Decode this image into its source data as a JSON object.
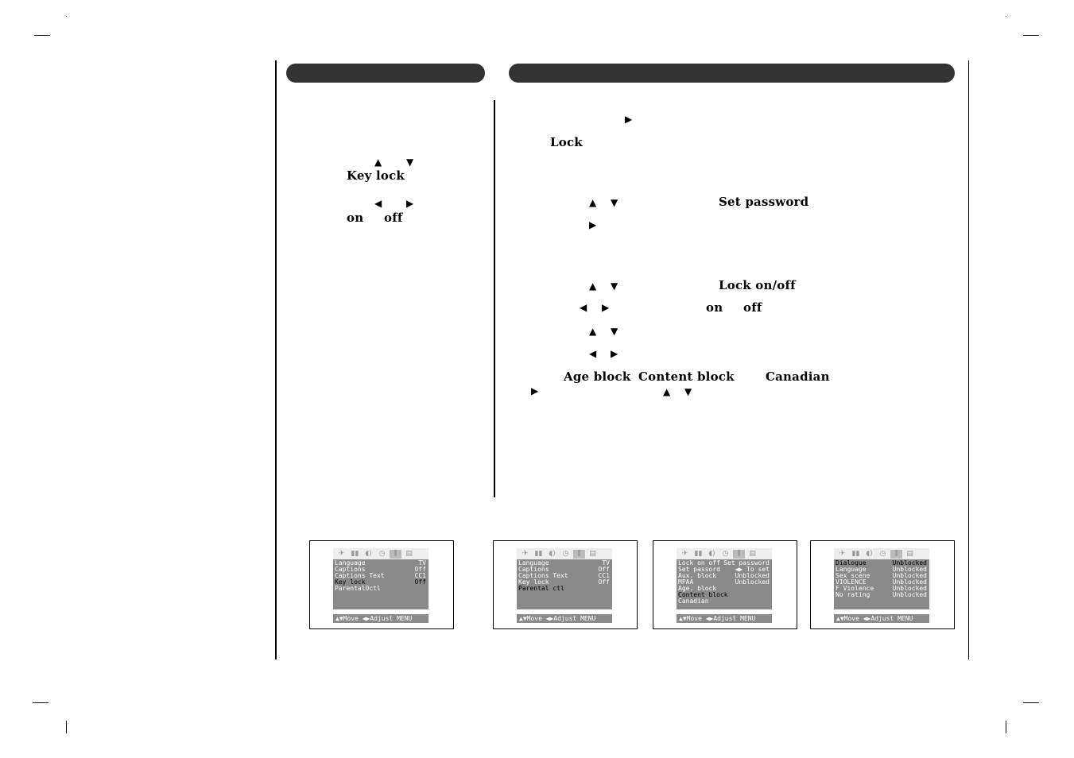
{
  "left_column": {
    "arrows_updown": [
      "▲",
      "▼"
    ],
    "key_lock_label": "Key lock",
    "arrows_leftright": [
      "◀",
      "▶"
    ],
    "on_label": "on",
    "off_label": "off"
  },
  "right_column": {
    "step1_arrow": "▶",
    "lock_label": "Lock",
    "step2_arrows": [
      "▲",
      "▼"
    ],
    "set_password_label": "Set password",
    "step2_right_arrow": "▶",
    "step3_arrows": [
      "▲",
      "▼"
    ],
    "lock_onoff_label": "Lock on/off",
    "step4_arrows": [
      "◀",
      "▶"
    ],
    "on_label": "on",
    "off_label": "off",
    "step5_arrows": [
      "▲",
      "▼"
    ],
    "step6_arrows": [
      "◀",
      "▶"
    ],
    "age_block_label": "Age block",
    "content_block_label": "Content block",
    "canadian_label": "Canadian",
    "step7_right_arrow": "▶",
    "step7_arrows": [
      "▲",
      "▼"
    ]
  },
  "icons": [
    "satellite-icon",
    "picture-icon",
    "sound-icon",
    "clock-icon",
    "special-icon",
    "screen-icon"
  ],
  "icon_glyphs": [
    "✈",
    "▮▮",
    "◖)",
    "◷",
    "⫼",
    "▤"
  ],
  "screens": [
    {
      "rows": [
        {
          "label": "Language",
          "value": "TV",
          "selected": false
        },
        {
          "label": "Captions",
          "value": "Off",
          "selected": false
        },
        {
          "label": "Captions Text",
          "value": "CC1",
          "selected": false
        },
        {
          "label": "Key lock",
          "value": "Off",
          "selected": true
        },
        {
          "label": "ParentalOctl",
          "value": "",
          "selected": false
        }
      ],
      "footer": "▲▼Move ◀▶Adjust MENU"
    },
    {
      "rows": [
        {
          "label": "Language",
          "value": "TV",
          "selected": false
        },
        {
          "label": "Captions",
          "value": "Off",
          "selected": false
        },
        {
          "label": "Captions Text",
          "value": "CC1",
          "selected": false
        },
        {
          "label": "Key lock",
          "value": "Off",
          "selected": false
        },
        {
          "label": "Parental ctl",
          "value": "",
          "selected": true
        }
      ],
      "footer": "▲▼Move ◀▶Adjust MENU"
    },
    {
      "rows": [
        {
          "label": "Lock on off",
          "value": "Set password",
          "selected": false
        },
        {
          "label": "Set passord",
          "value": "◀▶ To set",
          "selected": false
        },
        {
          "label": "Aux. block",
          "value": "Unblocked",
          "selected": false
        },
        {
          "label": "MPAA",
          "value": "Unblocked",
          "selected": false
        },
        {
          "label": "Age. block",
          "value": "",
          "selected": false
        },
        {
          "label": "Content block",
          "value": "",
          "selected": true
        },
        {
          "label": "Canadian",
          "value": "",
          "selected": false
        }
      ],
      "footer": "▲▼Move ◀▶Adjust MENU"
    },
    {
      "rows": [
        {
          "label": "Dialogue",
          "value": "Unblocked",
          "selected": true
        },
        {
          "label": "Language",
          "value": "Unblocked",
          "selected": false
        },
        {
          "label": "Sex scene",
          "value": "Unblocked",
          "selected": false
        },
        {
          "label": "VIOLENCE",
          "value": "Unblocked",
          "selected": false
        },
        {
          "label": "F Violence",
          "value": "Unblocked",
          "selected": false
        },
        {
          "label": "No rating",
          "value": "Unblocked",
          "selected": false
        }
      ],
      "footer": "▲▼Move ◀▶Adjust MENU"
    }
  ]
}
